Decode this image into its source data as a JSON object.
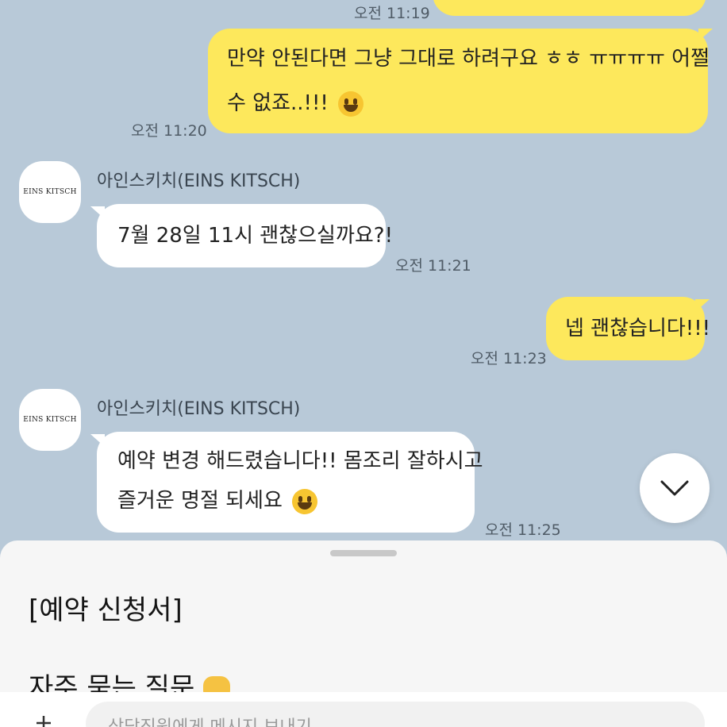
{
  "messages": [
    {
      "from": "me",
      "time": "오전 11:19"
    },
    {
      "from": "me",
      "line1": "만약 안된다면 그냥 그대로 하려구요 ㅎㅎ ㅠㅠㅠㅠ 어쩔",
      "line2": "수 없죠..!!!",
      "time": "오전 11:20"
    },
    {
      "from": "them",
      "sender": "아인스키치(EINS KITSCH)",
      "avatar": "EINS KITSCH",
      "text": "7월 28일 11시 괜찮으실까요?!",
      "time": "오전 11:21"
    },
    {
      "from": "me",
      "text": "넵 괜찮습니다!!!",
      "time": "오전 11:23"
    },
    {
      "from": "them",
      "sender": "아인스키치(EINS KITSCH)",
      "avatar": "EINS KITSCH",
      "line1": "예약 변경 해드렸습니다!! 몸조리 잘하시고",
      "line2": "즐거운 명절 되세요",
      "time": "오전 11:25"
    }
  ],
  "sheet": {
    "item1": "[예약 신청서]",
    "item2": "자주 묻는 질문"
  },
  "input": {
    "placeholder": "상담직원에게 메시지 보내기"
  },
  "colors": {
    "background": "#b8c9d8",
    "my_bubble": "#fde85c",
    "their_bubble": "#ffffff"
  }
}
